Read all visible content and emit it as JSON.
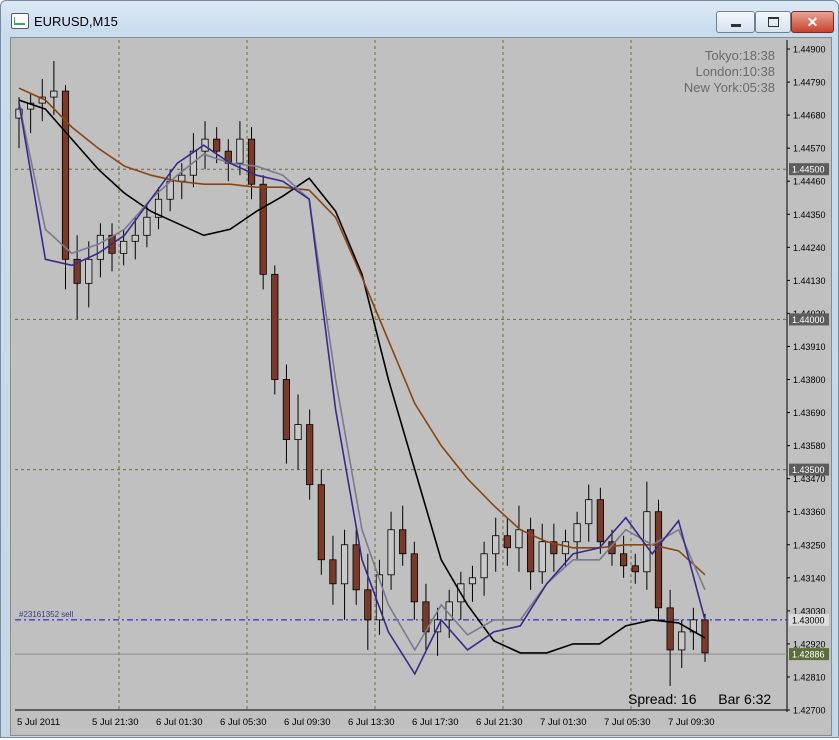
{
  "window": {
    "title": "EURUSD,M15",
    "minimize_icon": "minimize-icon",
    "maximize_icon": "restore-icon",
    "close_icon": "close-icon"
  },
  "clocks": {
    "tokyo": "Tokyo:18:38",
    "london": "London:10:38",
    "new_york": "New York:05:38"
  },
  "status": {
    "spread": "Spread: 16",
    "bar": "Bar  6:32"
  },
  "order_line": {
    "label": "#23161352 sell",
    "price": "1.43000",
    "color": "#1010d0"
  },
  "current_price": {
    "label": "1.42886",
    "color": "#5a6e3a"
  },
  "chart_data": {
    "type": "candlestick",
    "symbol": "EURUSD",
    "timeframe": "M15",
    "y_ticks": [
      "1.44900",
      "1.44790",
      "1.44680",
      "1.44570",
      "1.44460",
      "1.44350",
      "1.44240",
      "1.44130",
      "1.44020",
      "1.43910",
      "1.43800",
      "1.43690",
      "1.43580",
      "1.43470",
      "1.43360",
      "1.43250",
      "1.43140",
      "1.43030",
      "1.42920",
      "1.42810",
      "1.42700"
    ],
    "hl_levels": [
      "1.44500",
      "1.44000",
      "1.43500"
    ],
    "x_ticks": [
      "5 Jul 2011",
      "5 Jul 21:30",
      "6 Jul 01:30",
      "6 Jul 05:30",
      "6 Jul 09:30",
      "6 Jul 13:30",
      "6 Jul 17:30",
      "6 Jul 21:30",
      "7 Jul 01:30",
      "7 Jul 05:30",
      "7 Jul 09:30"
    ],
    "ylim": [
      1.427,
      1.4493
    ],
    "grid": true,
    "series": [
      {
        "name": "",
        "color": "#000000",
        "values": [
          1.4473,
          1.447,
          1.446,
          1.445,
          1.4442,
          1.4436,
          1.4432,
          1.4428,
          1.443,
          1.4436,
          1.4441,
          1.4447,
          1.4436,
          1.4415,
          1.438,
          1.435,
          1.432,
          1.4305,
          1.4293,
          1.4289,
          1.4289,
          1.4292,
          1.4292,
          1.4298,
          1.43,
          1.4299,
          1.4294
        ]
      },
      {
        "name": "",
        "color": "#8b4513",
        "values": [
          1.4477,
          1.4473,
          1.4464,
          1.4457,
          1.4451,
          1.4448,
          1.4446,
          1.4445,
          1.4445,
          1.4444,
          1.4444,
          1.4443,
          1.4434,
          1.4414,
          1.4393,
          1.4372,
          1.4358,
          1.4347,
          1.4338,
          1.433,
          1.4326,
          1.4324,
          1.4324,
          1.4325,
          1.4325,
          1.4323,
          1.4315
        ]
      },
      {
        "name": "",
        "color": "#7a7a90",
        "values": [
          1.4472,
          1.443,
          1.4422,
          1.4425,
          1.443,
          1.444,
          1.4448,
          1.4455,
          1.4452,
          1.4451,
          1.4448,
          1.444,
          1.438,
          1.433,
          1.4305,
          1.429,
          1.4305,
          1.4295,
          1.43,
          1.43,
          1.4312,
          1.432,
          1.432,
          1.433,
          1.4325,
          1.433,
          1.431
        ]
      },
      {
        "name": "",
        "color": "#3a2a8a",
        "values": [
          1.4472,
          1.442,
          1.4418,
          1.4422,
          1.4428,
          1.444,
          1.4452,
          1.4458,
          1.4452,
          1.4448,
          1.4446,
          1.444,
          1.437,
          1.432,
          1.4296,
          1.4282,
          1.43,
          1.429,
          1.4296,
          1.4298,
          1.4312,
          1.4322,
          1.4324,
          1.4334,
          1.4322,
          1.4333,
          1.43
        ]
      }
    ],
    "candles": [
      [
        1.4467,
        1.4474,
        1.4457,
        1.447
      ],
      [
        1.447,
        1.4475,
        1.4462,
        1.4472
      ],
      [
        1.4472,
        1.448,
        1.4466,
        1.4474
      ],
      [
        1.4474,
        1.4486,
        1.4468,
        1.4476
      ],
      [
        1.4476,
        1.4478,
        1.441,
        1.442
      ],
      [
        1.442,
        1.4428,
        1.44,
        1.4412
      ],
      [
        1.4412,
        1.4426,
        1.4404,
        1.442
      ],
      [
        1.442,
        1.4432,
        1.4414,
        1.4428
      ],
      [
        1.4428,
        1.4432,
        1.4416,
        1.4422
      ],
      [
        1.4422,
        1.443,
        1.4418,
        1.4426
      ],
      [
        1.4426,
        1.4434,
        1.442,
        1.4428
      ],
      [
        1.4428,
        1.4438,
        1.4424,
        1.4434
      ],
      [
        1.4434,
        1.4444,
        1.443,
        1.444
      ],
      [
        1.444,
        1.445,
        1.4436,
        1.4446
      ],
      [
        1.4446,
        1.4452,
        1.444,
        1.4448
      ],
      [
        1.4448,
        1.4462,
        1.4444,
        1.4456
      ],
      [
        1.4456,
        1.4466,
        1.445,
        1.446
      ],
      [
        1.446,
        1.4464,
        1.4452,
        1.4456
      ],
      [
        1.4456,
        1.446,
        1.4446,
        1.4452
      ],
      [
        1.4452,
        1.4466,
        1.4448,
        1.446
      ],
      [
        1.446,
        1.4464,
        1.444,
        1.4445
      ],
      [
        1.4445,
        1.4448,
        1.441,
        1.4415
      ],
      [
        1.4415,
        1.4418,
        1.4375,
        1.438
      ],
      [
        1.438,
        1.4385,
        1.4352,
        1.436
      ],
      [
        1.436,
        1.4375,
        1.435,
        1.4365
      ],
      [
        1.4365,
        1.437,
        1.434,
        1.4345
      ],
      [
        1.4345,
        1.435,
        1.4315,
        1.432
      ],
      [
        1.432,
        1.4328,
        1.4305,
        1.4312
      ],
      [
        1.4312,
        1.433,
        1.43,
        1.4325
      ],
      [
        1.4325,
        1.433,
        1.4305,
        1.431
      ],
      [
        1.431,
        1.4322,
        1.429,
        1.43
      ],
      [
        1.43,
        1.432,
        1.4295,
        1.4315
      ],
      [
        1.4315,
        1.4336,
        1.431,
        1.433
      ],
      [
        1.433,
        1.4338,
        1.4318,
        1.4322
      ],
      [
        1.4322,
        1.4326,
        1.43,
        1.4306
      ],
      [
        1.4306,
        1.4312,
        1.429,
        1.4296
      ],
      [
        1.4296,
        1.4304,
        1.4288,
        1.43
      ],
      [
        1.43,
        1.431,
        1.4294,
        1.4306
      ],
      [
        1.4306,
        1.4316,
        1.43,
        1.4312
      ],
      [
        1.4312,
        1.4318,
        1.4306,
        1.4314
      ],
      [
        1.4314,
        1.4326,
        1.4308,
        1.4322
      ],
      [
        1.4322,
        1.4334,
        1.4316,
        1.4328
      ],
      [
        1.4328,
        1.4334,
        1.4318,
        1.4324
      ],
      [
        1.4324,
        1.4338,
        1.4316,
        1.433
      ],
      [
        1.433,
        1.4334,
        1.431,
        1.4316
      ],
      [
        1.4316,
        1.4332,
        1.4312,
        1.4326
      ],
      [
        1.4326,
        1.4332,
        1.4316,
        1.4322
      ],
      [
        1.4322,
        1.433,
        1.4318,
        1.4326
      ],
      [
        1.4326,
        1.4336,
        1.432,
        1.4332
      ],
      [
        1.4332,
        1.4345,
        1.4326,
        1.434
      ],
      [
        1.434,
        1.4344,
        1.4322,
        1.4326
      ],
      [
        1.4326,
        1.433,
        1.4318,
        1.4322
      ],
      [
        1.4322,
        1.4328,
        1.4314,
        1.4318
      ],
      [
        1.4318,
        1.4322,
        1.4312,
        1.4316
      ],
      [
        1.4316,
        1.4346,
        1.431,
        1.4336
      ],
      [
        1.4336,
        1.434,
        1.43,
        1.4304
      ],
      [
        1.4304,
        1.431,
        1.4278,
        1.429
      ],
      [
        1.429,
        1.43,
        1.4284,
        1.4296
      ],
      [
        1.4296,
        1.4304,
        1.429,
        1.43
      ],
      [
        1.43,
        1.4302,
        1.4286,
        1.4289
      ]
    ]
  }
}
